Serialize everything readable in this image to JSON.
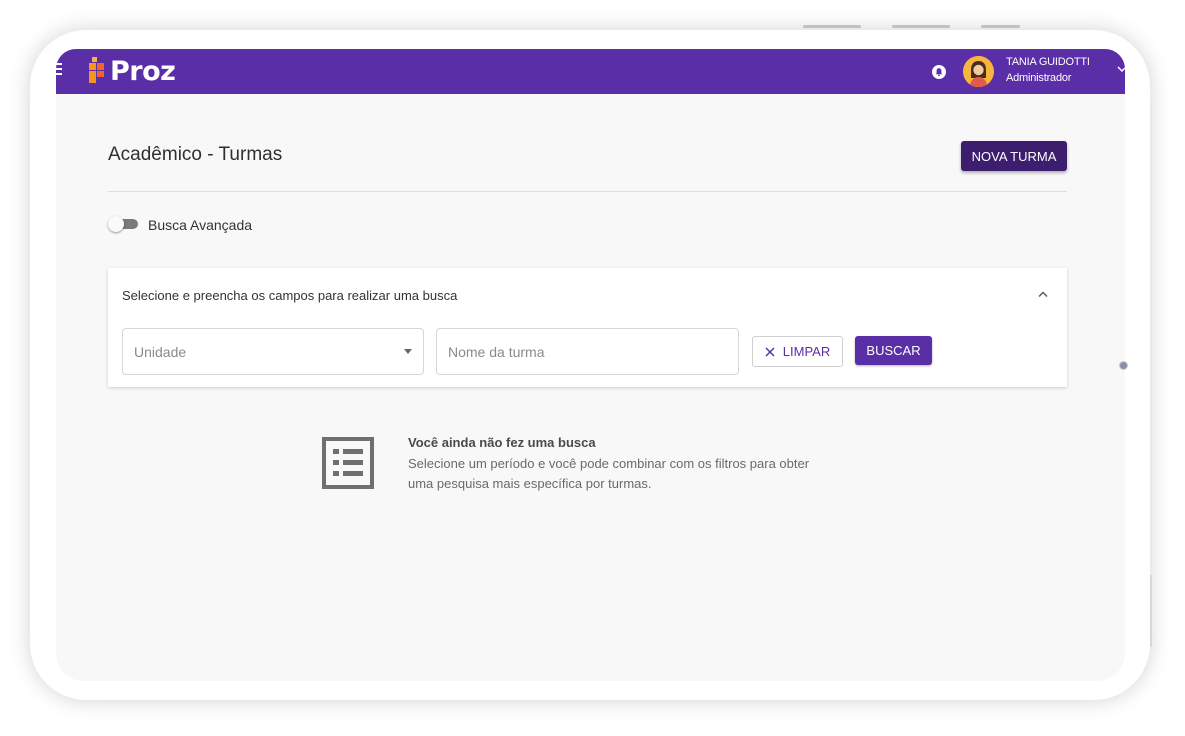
{
  "header": {
    "logo_text": "Proz",
    "user_name": "TANIA GUIDOTTI",
    "user_role": "Administrador",
    "accent_color": "#5a2ea6"
  },
  "page": {
    "title": "Acadêmico - Turmas",
    "new_button": "NOVA TURMA"
  },
  "advanced_search": {
    "label": "Busca Avançada",
    "enabled": false
  },
  "search_panel": {
    "header": "Selecione e preencha os campos para realizar uma busca",
    "unidade_placeholder": "Unidade",
    "nome_placeholder": "Nome da turma",
    "clear_button": "LIMPAR",
    "search_button": "BUSCAR"
  },
  "empty_state": {
    "title": "Você ainda não fez uma busca",
    "description": "Selecione um período e você pode combinar com os filtros para obter uma pesquisa mais específica por turmas.",
    "icon": "list-icon"
  }
}
